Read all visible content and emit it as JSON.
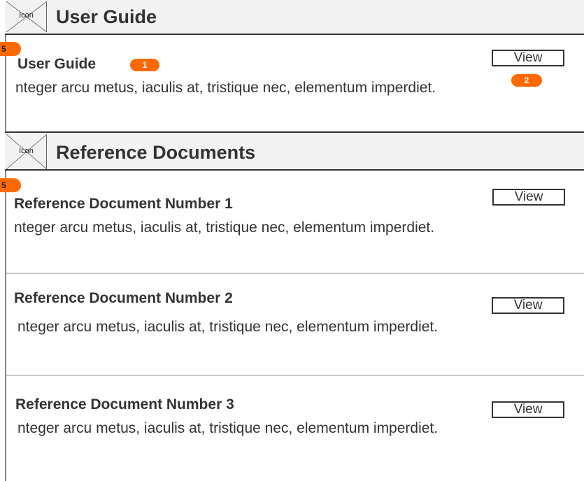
{
  "sections": [
    {
      "icon_label": "Icon",
      "title": "User Guide",
      "corner_badge": "5",
      "items": [
        {
          "title": "User Guide",
          "desc": "nteger arcu metus, iaculis at, tristique nec, elementum imperdiet.",
          "button": "View",
          "title_badge": "1",
          "button_badge": "2"
        }
      ]
    },
    {
      "icon_label": "Icon",
      "title": "Reference Documents",
      "corner_badge": "5",
      "items": [
        {
          "title": "Reference Document Number 1",
          "desc": "nteger arcu metus, iaculis at, tristique nec, elementum imperdiet.",
          "button": "View"
        },
        {
          "title": "Reference Document Number 2",
          "desc": "nteger arcu metus, iaculis at, tristique nec, elementum imperdiet.",
          "button": "View"
        },
        {
          "title": "Reference Document Number 3",
          "desc": "nteger arcu metus, iaculis at, tristique nec, elementum imperdiet.",
          "button": "View"
        }
      ]
    }
  ],
  "colors": {
    "badge": "#ff6a00",
    "header_bg": "#f2f2f2",
    "text": "#333333"
  }
}
